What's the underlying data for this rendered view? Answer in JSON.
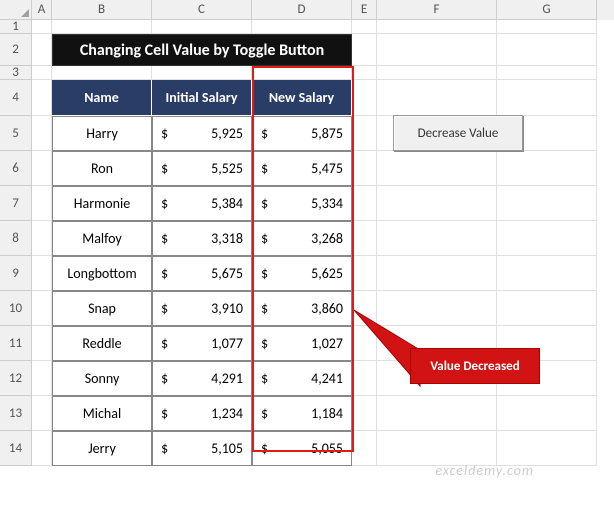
{
  "columns": [
    "A",
    "B",
    "C",
    "D",
    "E",
    "F",
    "G"
  ],
  "title": "Changing Cell Value by Toggle Button",
  "headers": {
    "name": "Name",
    "initial": "Initial Salary",
    "new": "New Salary"
  },
  "button_label": "Decrease Value",
  "callout_label": "Value Decreased",
  "currency": "$",
  "watermark": "exceldemy.com",
  "rows_nums": [
    "1",
    "2",
    "3",
    "4",
    "5",
    "6",
    "7",
    "8",
    "9",
    "10",
    "11",
    "12",
    "13",
    "14"
  ],
  "data": [
    {
      "name": "Harry",
      "initial": "5,925",
      "new": "5,875"
    },
    {
      "name": "Ron",
      "initial": "5,525",
      "new": "5,475"
    },
    {
      "name": "Harmonie",
      "initial": "5,384",
      "new": "5,334"
    },
    {
      "name": "Malfoy",
      "initial": "3,318",
      "new": "3,268"
    },
    {
      "name": "Longbottom",
      "initial": "5,675",
      "new": "5,625"
    },
    {
      "name": "Snap",
      "initial": "3,910",
      "new": "3,860"
    },
    {
      "name": "Reddle",
      "initial": "1,077",
      "new": "1,027"
    },
    {
      "name": "Sonny",
      "initial": "4,291",
      "new": "4,241"
    },
    {
      "name": "Michal",
      "initial": "1,234",
      "new": "1,184"
    },
    {
      "name": "Jerry",
      "initial": "5,105",
      "new": "5,055"
    }
  ],
  "chart_data": {
    "type": "table",
    "title": "Changing Cell Value by Toggle Button",
    "columns": [
      "Name",
      "Initial Salary",
      "New Salary"
    ],
    "rows": [
      [
        "Harry",
        5925,
        5875
      ],
      [
        "Ron",
        5525,
        5475
      ],
      [
        "Harmonie",
        5384,
        5334
      ],
      [
        "Malfoy",
        3318,
        3268
      ],
      [
        "Longbottom",
        5675,
        5625
      ],
      [
        "Snap",
        3910,
        3860
      ],
      [
        "Reddle",
        1077,
        1027
      ],
      [
        "Sonny",
        4291,
        4241
      ],
      [
        "Michal",
        1234,
        1184
      ],
      [
        "Jerry",
        5105,
        5055
      ]
    ]
  }
}
